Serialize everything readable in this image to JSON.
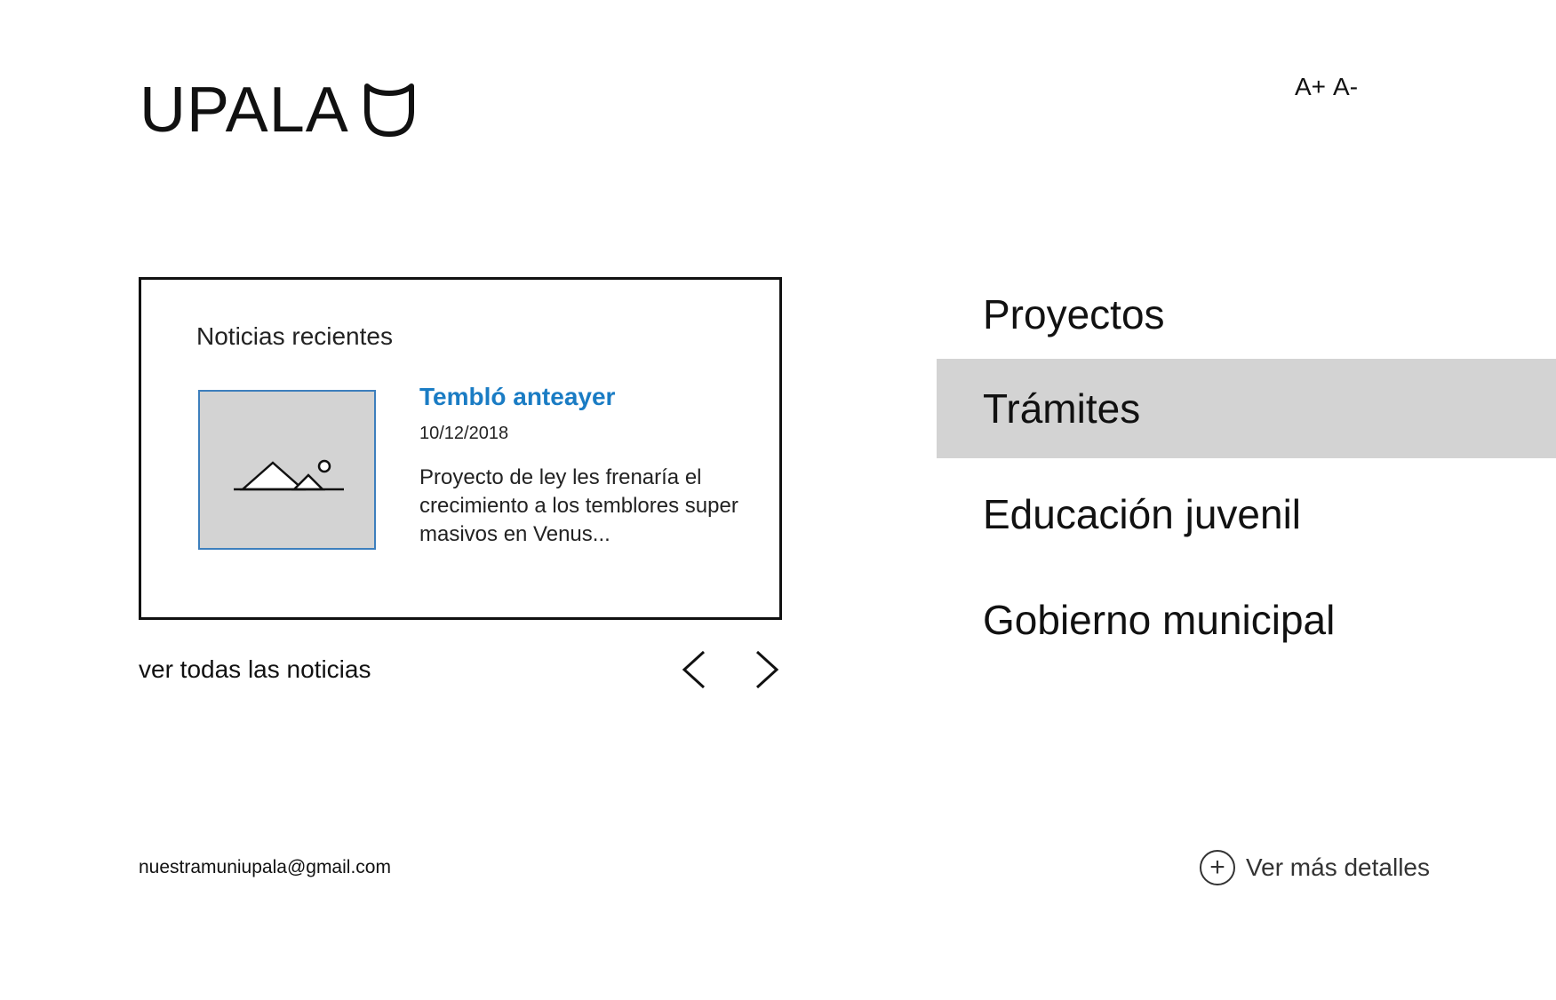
{
  "header": {
    "logo_text": "UPALA",
    "font_increase": "A+",
    "font_decrease": "A-"
  },
  "news": {
    "section_title": "Noticias recientes",
    "headline": "Tembló anteayer",
    "date": "10/12/2018",
    "excerpt": "Proyecto de ley les frenaría el crecimiento a los temblores super masivos en Venus...",
    "all_news_link": "ver todas las noticias",
    "thumbnail_icon": "image-placeholder-icon",
    "prev_icon": "chevron-left-icon",
    "next_icon": "chevron-right-icon"
  },
  "menu": {
    "items": [
      {
        "label": "Proyectos"
      },
      {
        "label": "Trámites",
        "active": true
      },
      {
        "label": "Educación juvenil"
      },
      {
        "label": "Gobierno municipal"
      }
    ]
  },
  "footer": {
    "email": "nuestramuniupala@gmail.com",
    "more_details_label": "Ver más detalles",
    "more_details_icon": "plus-circle-icon"
  },
  "colors": {
    "accent": "#1a7cc4",
    "active_menu_bg": "#d3d3d3",
    "thumbnail_border": "#3d7fbd"
  }
}
